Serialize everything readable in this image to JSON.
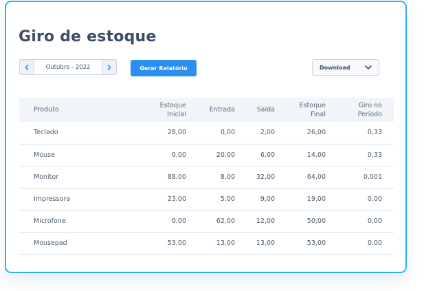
{
  "page": {
    "title": "Giro de estoque"
  },
  "toolbar": {
    "month_label": "Outubro - 2022",
    "generate_label": "Gerar Relatório",
    "download_label": "Download"
  },
  "table": {
    "headers": {
      "produto": "Produto",
      "estoque_inicial_1": "Estoque",
      "estoque_inicial_2": "Inicial",
      "entrada": "Entrada",
      "saida": "Saída",
      "estoque_final_1": "Estoque",
      "estoque_final_2": "Final",
      "giro_1": "Giro no",
      "giro_2": "Período"
    },
    "rows": [
      {
        "produto": "Teclado",
        "estoque_inicial": "28,00",
        "entrada": "0,00",
        "saida": "2,00",
        "estoque_final": "26,00",
        "giro": "0,33"
      },
      {
        "produto": "Mouse",
        "estoque_inicial": "0,00",
        "entrada": "20,00",
        "saida": "6,00",
        "estoque_final": "14,00",
        "giro": "0,33"
      },
      {
        "produto": "Monitor",
        "estoque_inicial": "88,00",
        "entrada": "8,00",
        "saida": "32,00",
        "estoque_final": "64,00",
        "giro": "0,001"
      },
      {
        "produto": "Impressora",
        "estoque_inicial": "23,00",
        "entrada": "5,00",
        "saida": "9,00",
        "estoque_final": "19,00",
        "giro": "0,00"
      },
      {
        "produto": "Microfone",
        "estoque_inicial": "0,00",
        "entrada": "62,00",
        "saida": "12,00",
        "estoque_final": "50,00",
        "giro": "0,00"
      },
      {
        "produto": "Mousepad",
        "estoque_inicial": "53,00",
        "entrada": "13,00",
        "saida": "13,00",
        "estoque_final": "53,00",
        "giro": "0,00"
      }
    ]
  },
  "icons": {
    "prev": "chevron-left-icon",
    "next": "chevron-right-icon",
    "dropdown": "chevron-down-icon"
  },
  "colors": {
    "card_border": "#29b6f0",
    "primary_button": "#2a8ff0",
    "title": "#3d4f66",
    "header_bg": "#f1f4f8"
  }
}
